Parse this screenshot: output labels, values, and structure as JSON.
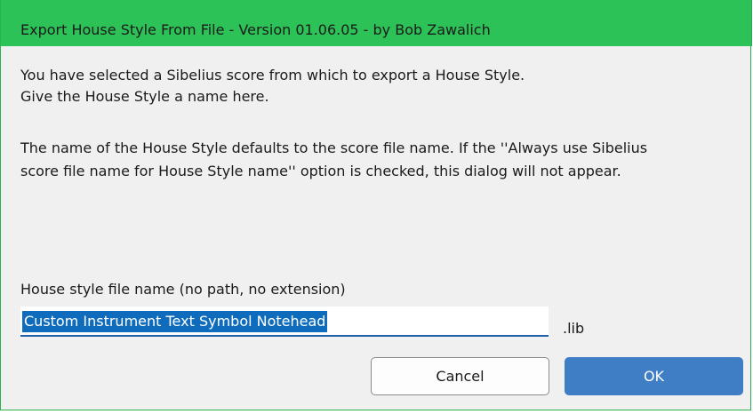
{
  "window": {
    "title": "Export House Style From File - Version 01.06.05 - by Bob Zawalich"
  },
  "message": {
    "line1": "You have selected a Sibelius score from which to export a House Style.",
    "line2": "Give the House Style a name here.",
    "line3": "The name of the House Style defaults to the score file name. If the ''Always use Sibelius",
    "line4": "score file name for House Style name'' option is checked, this dialog will not appear."
  },
  "field": {
    "label": "House style file name (no path, no extension)",
    "value": "Custom Instrument Text Symbol Notehead",
    "extension": ".lib"
  },
  "buttons": {
    "cancel": "Cancel",
    "ok": "OK"
  },
  "colors": {
    "titlebar": "#2dc257",
    "selection": "#0f6cbd",
    "ok_button": "#3f7ec5"
  }
}
